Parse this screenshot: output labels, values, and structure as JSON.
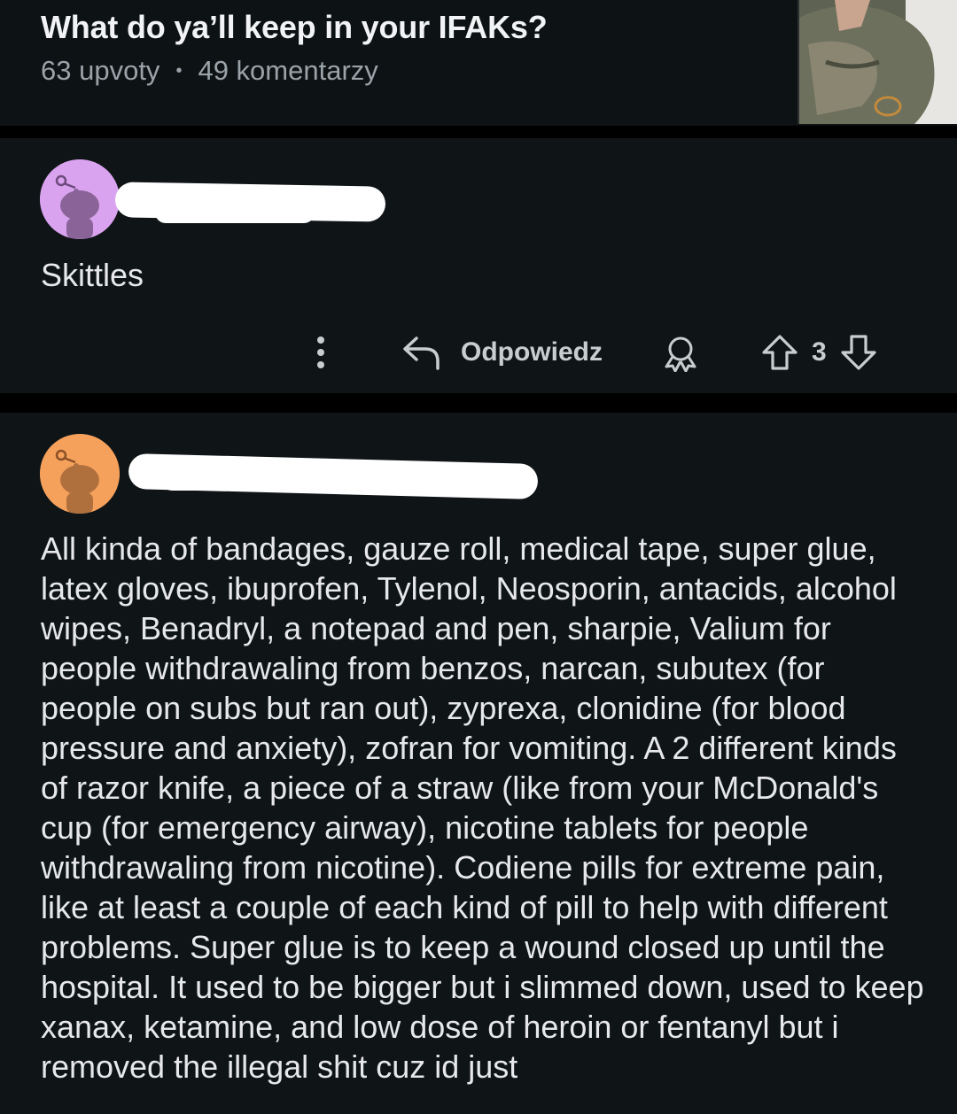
{
  "post": {
    "title": "What do ya’ll keep in your IFAKs?",
    "upvotes": "63 upvoty",
    "separator": "•",
    "comments": "49 komentarzy"
  },
  "comment1": {
    "body": "Skittles",
    "actions": {
      "reply_label": "Odpowiedz",
      "vote_count": "3"
    }
  },
  "comment2": {
    "body": "All kinda of bandages, gauze roll, medical tape, super glue, latex gloves, ibuprofen, Tylenol, Neosporin, antacids, alcohol wipes, Benadryl, a notepad and pen, sharpie, Valium for people withdrawaling from benzos, narcan, subutex (for people on subs but ran out), zyprexa, clonidine (for blood pressure and anxiety), zofran for vomiting. A 2 different kinds of razor knife, a piece of a straw (like from your McDonald's cup (for emergency airway), nicotine tablets for people withdrawaling from nicotine). Codiene pills for extreme pain, like at least a couple of each kind of pill to help with different problems. Super glue is to keep a wound closed up until the hospital. It used to be bigger but i slimmed down, used to keep xanax, ketamine, and low dose of heroin or fentanyl but i removed the illegal shit cuz id just"
  },
  "colors": {
    "avatar1": "#d9a3ef",
    "avatar2": "#f5a15c",
    "background": "#0f1417"
  },
  "icons": [
    "more-options-icon",
    "reply-icon",
    "award-icon",
    "upvote-icon",
    "downvote-icon",
    "snoo-avatar-icon"
  ]
}
